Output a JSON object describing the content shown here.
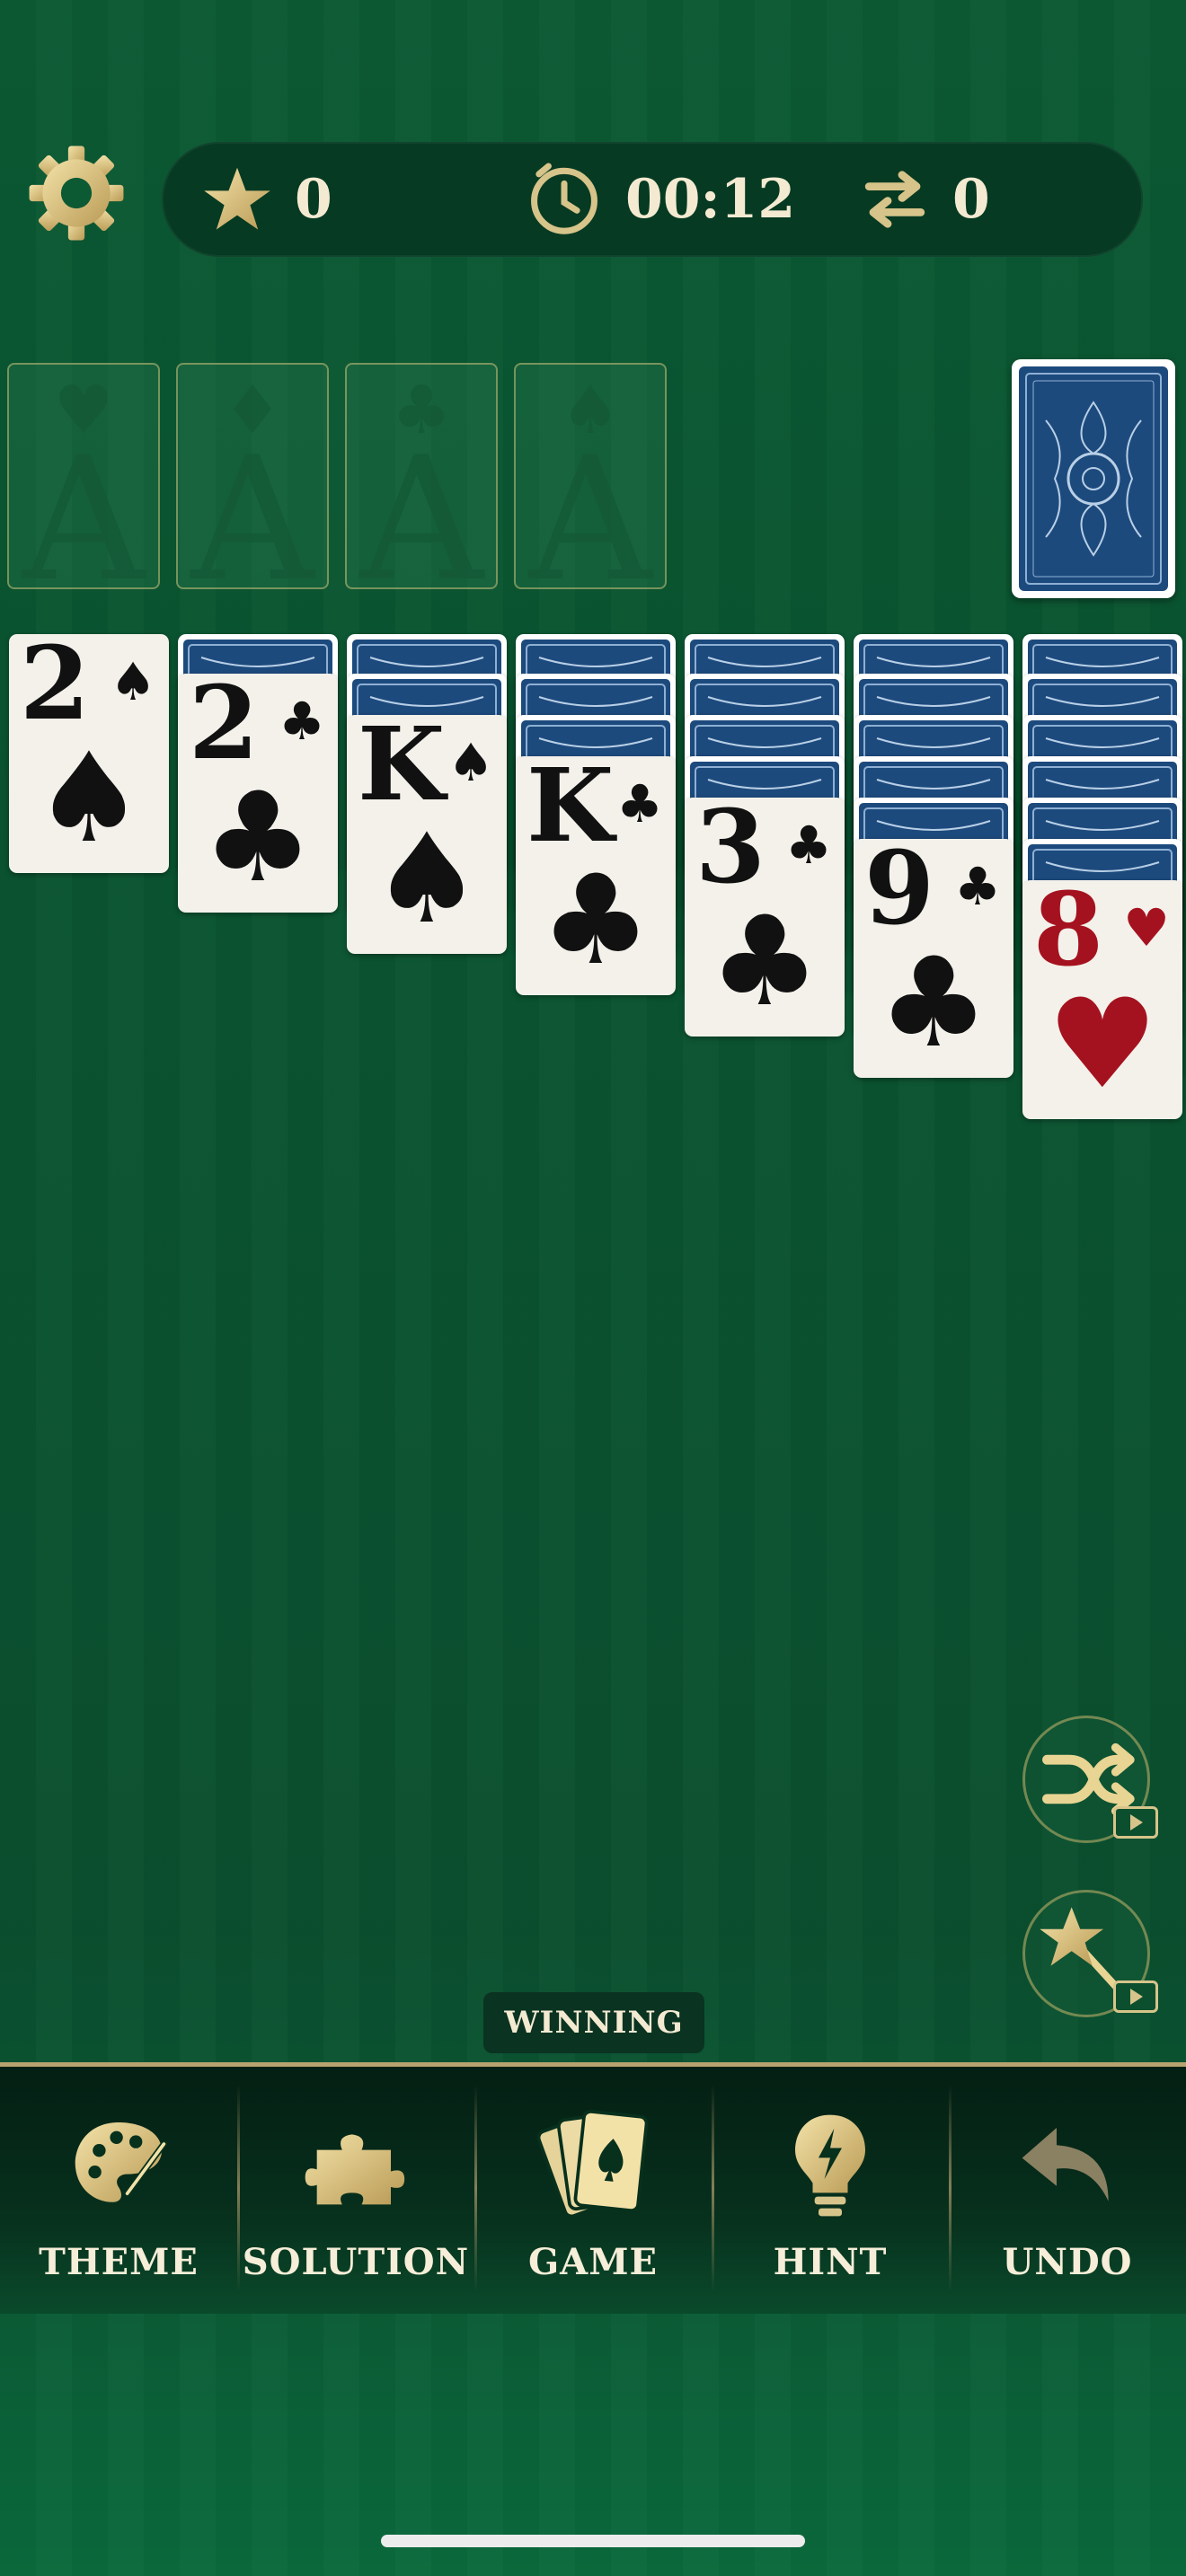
{
  "stats": {
    "score": "0",
    "time": "00:12",
    "moves": "0"
  },
  "foundations": [
    {
      "rank": "A",
      "suit": "♥"
    },
    {
      "rank": "A",
      "suit": "♦"
    },
    {
      "rank": "A",
      "suit": "♣"
    },
    {
      "rank": "A",
      "suit": "♠"
    }
  ],
  "tableau": [
    {
      "rank": "2",
      "suit": "♠",
      "color": "black"
    },
    {
      "rank": "2",
      "suit": "♣",
      "color": "black"
    },
    {
      "rank": "K",
      "suit": "♠",
      "color": "black"
    },
    {
      "rank": "K",
      "suit": "♣",
      "color": "black"
    },
    {
      "rank": "3",
      "suit": "♣",
      "color": "black"
    },
    {
      "rank": "9",
      "suit": "♣",
      "color": "black"
    },
    {
      "rank": "8",
      "suit": "♥",
      "color": "red"
    }
  ],
  "status_label": "WINNING",
  "nav": [
    {
      "label": "THEME",
      "icon": "palette-icon"
    },
    {
      "label": "SOLUTION",
      "icon": "puzzle-icon"
    },
    {
      "label": "GAME",
      "icon": "cards-icon"
    },
    {
      "label": "HINT",
      "icon": "lightbulb-icon"
    },
    {
      "label": "UNDO",
      "icon": "undo-icon"
    }
  ],
  "colors": {
    "felt": "#0a5230",
    "gold": "#d6c48a",
    "card_back": "#1d4a7d",
    "red_suit": "#a5121f"
  }
}
